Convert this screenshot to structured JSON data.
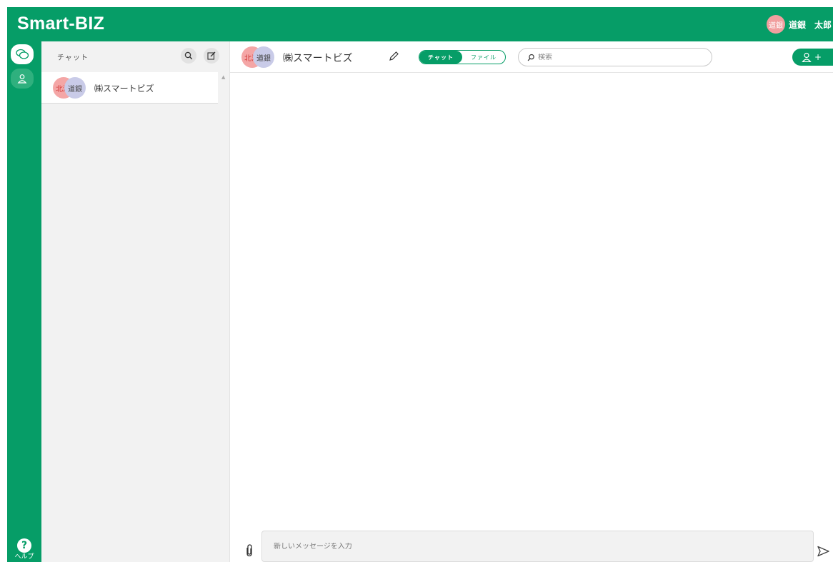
{
  "app": {
    "title": "Smart-BIZ"
  },
  "user": {
    "avatar_text": "道銀",
    "name": "道銀　太郎"
  },
  "rail": {
    "help_label": "ヘルプ",
    "help_glyph": "?"
  },
  "chat_list": {
    "title": "チャット",
    "items": [
      {
        "avatar_a": "北洋",
        "avatar_b": "道銀",
        "name": "㈱スマートビズ"
      }
    ]
  },
  "room": {
    "avatar_a": "北洋",
    "avatar_b": "道銀",
    "name": "㈱スマートビズ",
    "tabs": {
      "chat": "チャット",
      "file": "ファイル"
    },
    "search_placeholder": "検索",
    "add_member_plus": "+"
  },
  "composer": {
    "placeholder": "新しいメッセージを入力"
  },
  "colors": {
    "brand": "#069d67",
    "avatar_red": "#f4a6a6",
    "avatar_purple": "#c9cbe8"
  }
}
